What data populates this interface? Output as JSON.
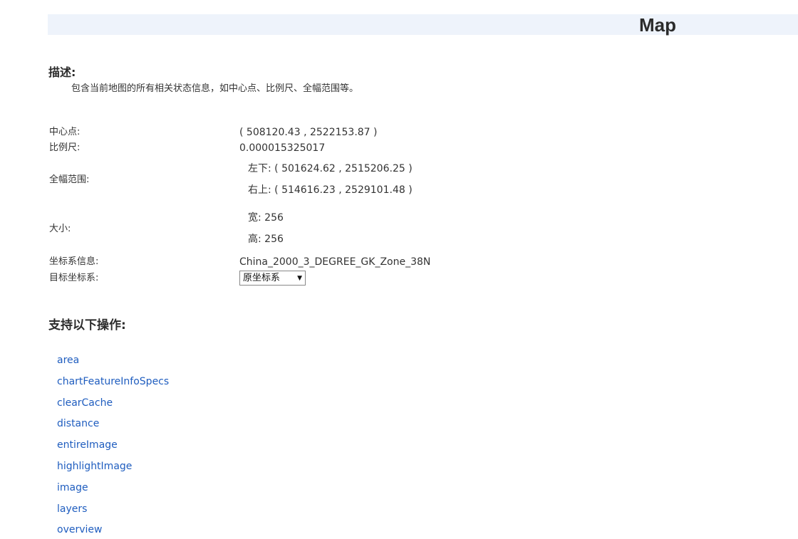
{
  "header": {
    "title": "Map"
  },
  "description": {
    "heading": "描述:",
    "text": "包含当前地图的所有相关状态信息，如中心点、比例尺、全幅范围等。"
  },
  "properties": {
    "center": {
      "label": "中心点:",
      "value": "( 508120.43 , 2522153.87 )"
    },
    "scale": {
      "label": "比例尺:",
      "value": "0.000015325017"
    },
    "bounds": {
      "label": "全幅范围:",
      "lower_left": "左下: ( 501624.62 , 2515206.25 )",
      "upper_right": "右上: ( 514616.23 , 2529101.48 )"
    },
    "size": {
      "label": "大小:",
      "width": "宽: 256",
      "height": "高: 256"
    },
    "crs": {
      "label": "坐标系信息:",
      "value": "China_2000_3_DEGREE_GK_Zone_38N"
    },
    "target_crs": {
      "label": "目标坐标系:",
      "selected": "原坐标系"
    }
  },
  "operations": {
    "heading": "支持以下操作:",
    "items": [
      "area",
      "chartFeatureInfoSpecs",
      "clearCache",
      "distance",
      "entireImage",
      "highlightImage",
      "image",
      "layers",
      "overview"
    ]
  },
  "colors": {
    "title_bar_bg": "#eef3fb",
    "link": "#1f5dbf",
    "text": "#333333"
  }
}
